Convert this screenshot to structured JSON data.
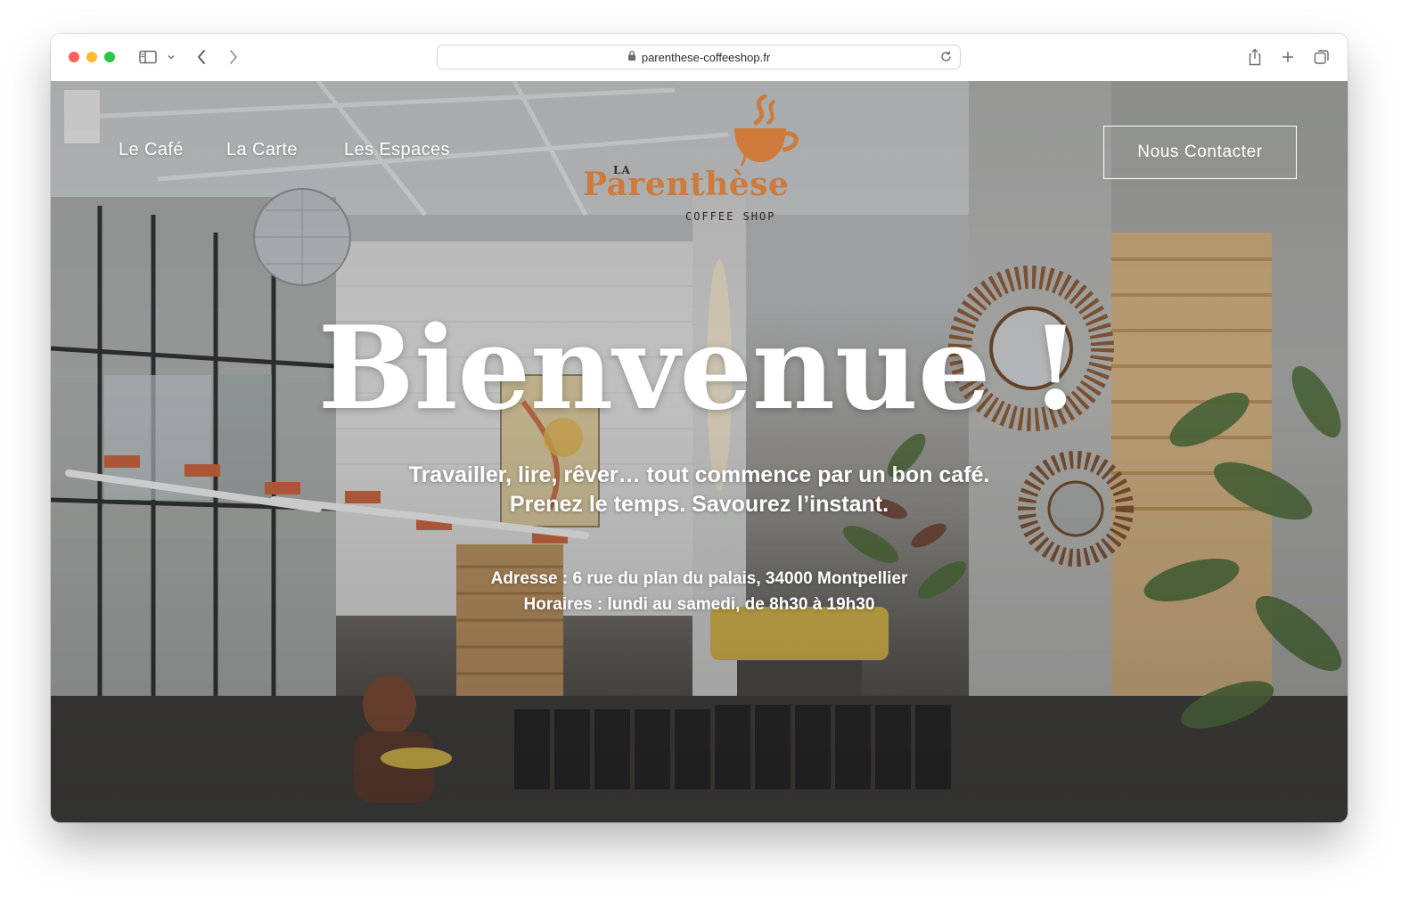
{
  "browser": {
    "url": "parenthese-coffeeshop.fr",
    "icons": {
      "sidebar": "sidebar-icon",
      "back": "chevron-left-icon",
      "forward": "chevron-right-icon",
      "lock": "lock-icon",
      "reload": "reload-icon",
      "share": "share-icon",
      "new_tab": "plus-icon",
      "tabs": "tabs-overview-icon"
    }
  },
  "nav": {
    "items": [
      {
        "label": "Le Café"
      },
      {
        "label": "La Carte"
      },
      {
        "label": "Les Espaces"
      }
    ],
    "contact_label": "Nous Contacter"
  },
  "logo": {
    "prefix": "LA",
    "name": "Parenthèse",
    "subtitle": "COFFEE SHOP",
    "icon": "coffee-cup-icon"
  },
  "hero": {
    "headline": "Bienvenue !",
    "tagline_line1": "Travailler, lire, rêver… tout commence par un bon café.",
    "tagline_line2": "Prenez le temps. Savourez l’instant.",
    "address": "Adresse : 6 rue du plan du palais, 34000 Montpellier",
    "hours": "Horaires : lundi au samedi, de 8h30 à 19h30"
  },
  "colors": {
    "brand_orange": "#cd7a3a",
    "text_white": "#ffffff"
  }
}
